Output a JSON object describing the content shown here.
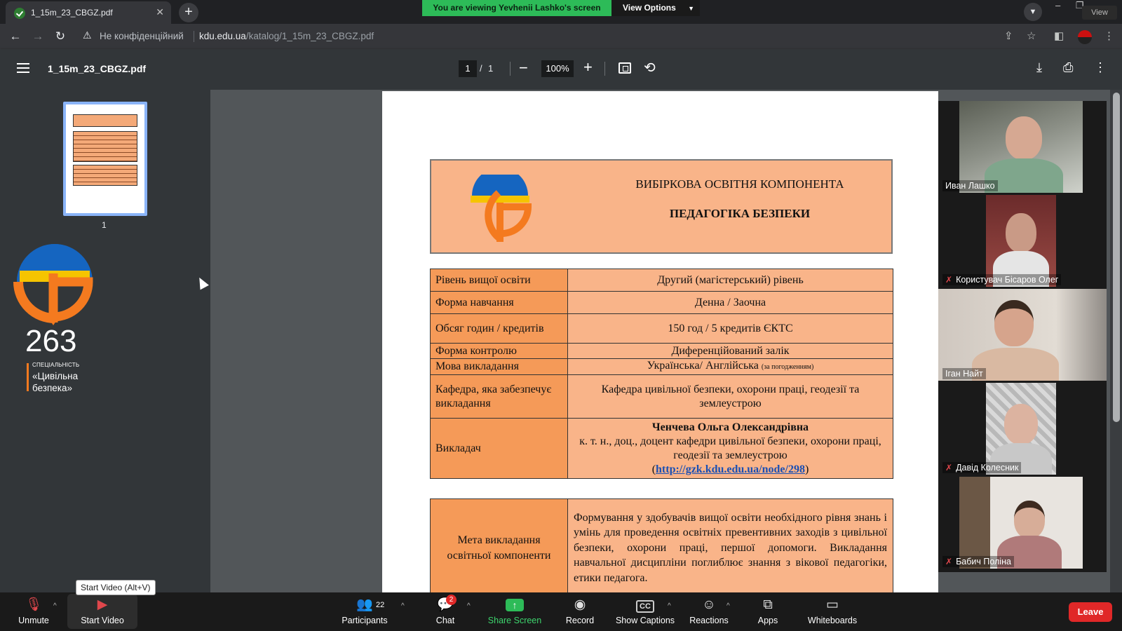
{
  "browser": {
    "tab_title": "1_15m_23_CBGZ.pdf",
    "tab_close": "✕",
    "new_tab": "+",
    "security_label": "Не конфіденційний",
    "url_host": "kdu.edu.ua",
    "url_path": "/katalog/1_15m_23_CBGZ.pdf",
    "view_button": "View",
    "window_controls": [
      "–",
      "❐",
      "✕"
    ]
  },
  "share_banner": {
    "message": "You are viewing Yevhenii Lashko's screen",
    "options_label": "View Options"
  },
  "pdf_viewer": {
    "file_name": "1_15m_23_CBGZ.pdf",
    "current_page": "1",
    "page_separator": "/",
    "total_pages": "1",
    "zoom": "100%",
    "thumbnail_label": "1"
  },
  "sidebar_logo": {
    "number": "263",
    "specialty_label": "СПЕЦІАЛЬНІСТЬ",
    "specialty_line1": "«Цивільна",
    "specialty_line2": "безпека»"
  },
  "document": {
    "header_line1": "ВИБІРКОВА ОСВІТНЯ КОМПОНЕНТА",
    "header_line2": "ПЕДАГОГІКА БЕЗПЕКИ",
    "rows": [
      {
        "label": "Рівень вищої освіти",
        "value": "Другий (магістерський) рівень"
      },
      {
        "label": "Форма навчання",
        "value": "Денна / Заочна"
      },
      {
        "label": "Обсяг годин / кредитів",
        "value": "150 год / 5 кредитів ЄКТС"
      },
      {
        "label": "Форма контролю",
        "value": "Диференційований залік"
      },
      {
        "label": "Мова викладання",
        "value": "Українська/ Англійська",
        "note": "(за погодженням)"
      },
      {
        "label": "Кафедра, яка забезпечує викладання",
        "value": "Кафедра цивільної безпеки, охорони праці, геодезії та землеустрою"
      }
    ],
    "teacher": {
      "label": "Викладач",
      "name": "Ченчева Ольга Олександрівна",
      "position": "к. т. н., доц., доцент кафедри цивільної безпеки, охорони праці, геодезії та землеустрою",
      "link": "http://gzk.kdu.edu.ua/node/298"
    },
    "aim": {
      "label": "Мета викладання освітньої компоненти",
      "text": "Формування у здобувачів вищої освіти необхідного рівня знань і умінь для проведення освітніх превентивних заходів з цивільної безпеки, охорони праці, першої допомоги. Викладання навчальної дисципліни поглиблює знання з вікової педагогіки,",
      "text_last": "етики педагога."
    }
  },
  "participants": [
    {
      "name": "Иван Лашко",
      "muted": false
    },
    {
      "name": "Користувач Бісаров Олег",
      "muted": true
    },
    {
      "name": "Іган Найт",
      "muted": false
    },
    {
      "name": "Давід Колесник",
      "muted": true
    },
    {
      "name": "Бабич Поліна",
      "muted": true
    }
  ],
  "meeting_bar": {
    "unmute": "Unmute",
    "start_video": "Start Video",
    "start_video_tooltip": "Start Video (Alt+V)",
    "participants": "Participants",
    "participants_count": "22",
    "chat": "Chat",
    "chat_badge": "2",
    "share_screen": "Share Screen",
    "record": "Record",
    "show_captions": "Show Captions",
    "captions_icon_text": "CC",
    "reactions": "Reactions",
    "apps": "Apps",
    "whiteboards": "Whiteboards",
    "leave": "Leave"
  },
  "colors": {
    "pdf_header_fill": "#f9b489",
    "pdf_label_fill": "#f59a58",
    "share_green": "#2dbb58",
    "leave_red": "#e02828"
  }
}
